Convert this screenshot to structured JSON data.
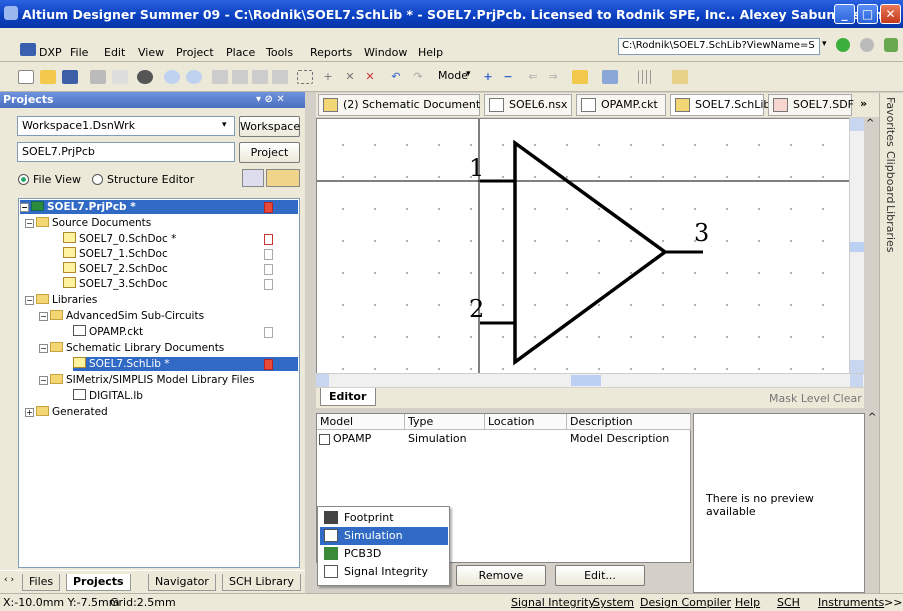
{
  "window": {
    "title": "Altium Designer Summer 09 - C:\\Rodnik\\SOEL7.SchLib * - SOEL7.PrjPcb. Licensed to Rodnik SPE, Inc.. Alexey Sabunin signed in."
  },
  "menu": {
    "items": [
      "DXP",
      "File",
      "Edit",
      "View",
      "Project",
      "Place",
      "Tools",
      "Reports",
      "Window",
      "Help"
    ],
    "path_combo": "C:\\Rodnik\\SOEL7.SchLib?ViewName=S"
  },
  "toolbar": {
    "mode_label": "Mode"
  },
  "projects": {
    "header": "Projects",
    "workspace_value": "Workspace1.DsnWrk",
    "workspace_button": "Workspace",
    "project_value": "SOEL7.PrjPcb",
    "project_button": "Project",
    "view_file": "File View",
    "view_structure": "Structure Editor",
    "tree": [
      {
        "label": "SOEL7.PrjPcb *",
        "level": 0
      },
      {
        "label": "Source Documents",
        "level": 1
      },
      {
        "label": "SOEL7_0.SchDoc *",
        "level": 2
      },
      {
        "label": "SOEL7_1.SchDoc",
        "level": 2
      },
      {
        "label": "SOEL7_2.SchDoc",
        "level": 2
      },
      {
        "label": "SOEL7_3.SchDoc",
        "level": 2
      },
      {
        "label": "Libraries",
        "level": 1
      },
      {
        "label": "AdvancedSim Sub-Circuits",
        "level": 2
      },
      {
        "label": "OPAMP.ckt",
        "level": 3
      },
      {
        "label": "Schematic Library Documents",
        "level": 2
      },
      {
        "label": "SOEL7.SchLib *",
        "level": 3
      },
      {
        "label": "SIMetrix/SIMPLIS Model Library Files",
        "level": 2
      },
      {
        "label": "DIGITAL.lb",
        "level": 3
      },
      {
        "label": "Generated",
        "level": 1
      }
    ],
    "tabs": [
      "Files",
      "Projects",
      "Navigator",
      "SCH Library"
    ]
  },
  "doc_tabs": [
    "(2) Schematic Document",
    "SOEL6.nsx",
    "OPAMP.ckt",
    "SOEL7.SchLib *",
    "SOEL7.SDF"
  ],
  "side_panels": [
    "Favorites",
    "Clipboard",
    "Libraries"
  ],
  "schematic": {
    "pin1": "1",
    "pin2": "2",
    "pin3": "3"
  },
  "editor": {
    "tab": "Editor",
    "mask_level": "Mask Level",
    "clear": "Clear",
    "columns": [
      "Model",
      "Type",
      "Location",
      "Description"
    ],
    "rows": [
      {
        "model": "OPAMP",
        "type": "Simulation",
        "location": "",
        "description": "Model Description"
      }
    ],
    "preview_text": "There is no preview available",
    "remove_button": "Remove",
    "edit_button": "Edit...",
    "popup_items": [
      "Footprint",
      "Simulation",
      "PCB3D",
      "Signal Integrity"
    ],
    "popup_selected": "Simulation"
  },
  "status": {
    "coords": "X:-10.0mm Y:-7.5mm",
    "grid": "Grid:2.5mm",
    "items": [
      "Signal Integrity",
      "System",
      "Design Compiler",
      "Help",
      "SCH",
      "Instruments",
      ">>"
    ]
  }
}
